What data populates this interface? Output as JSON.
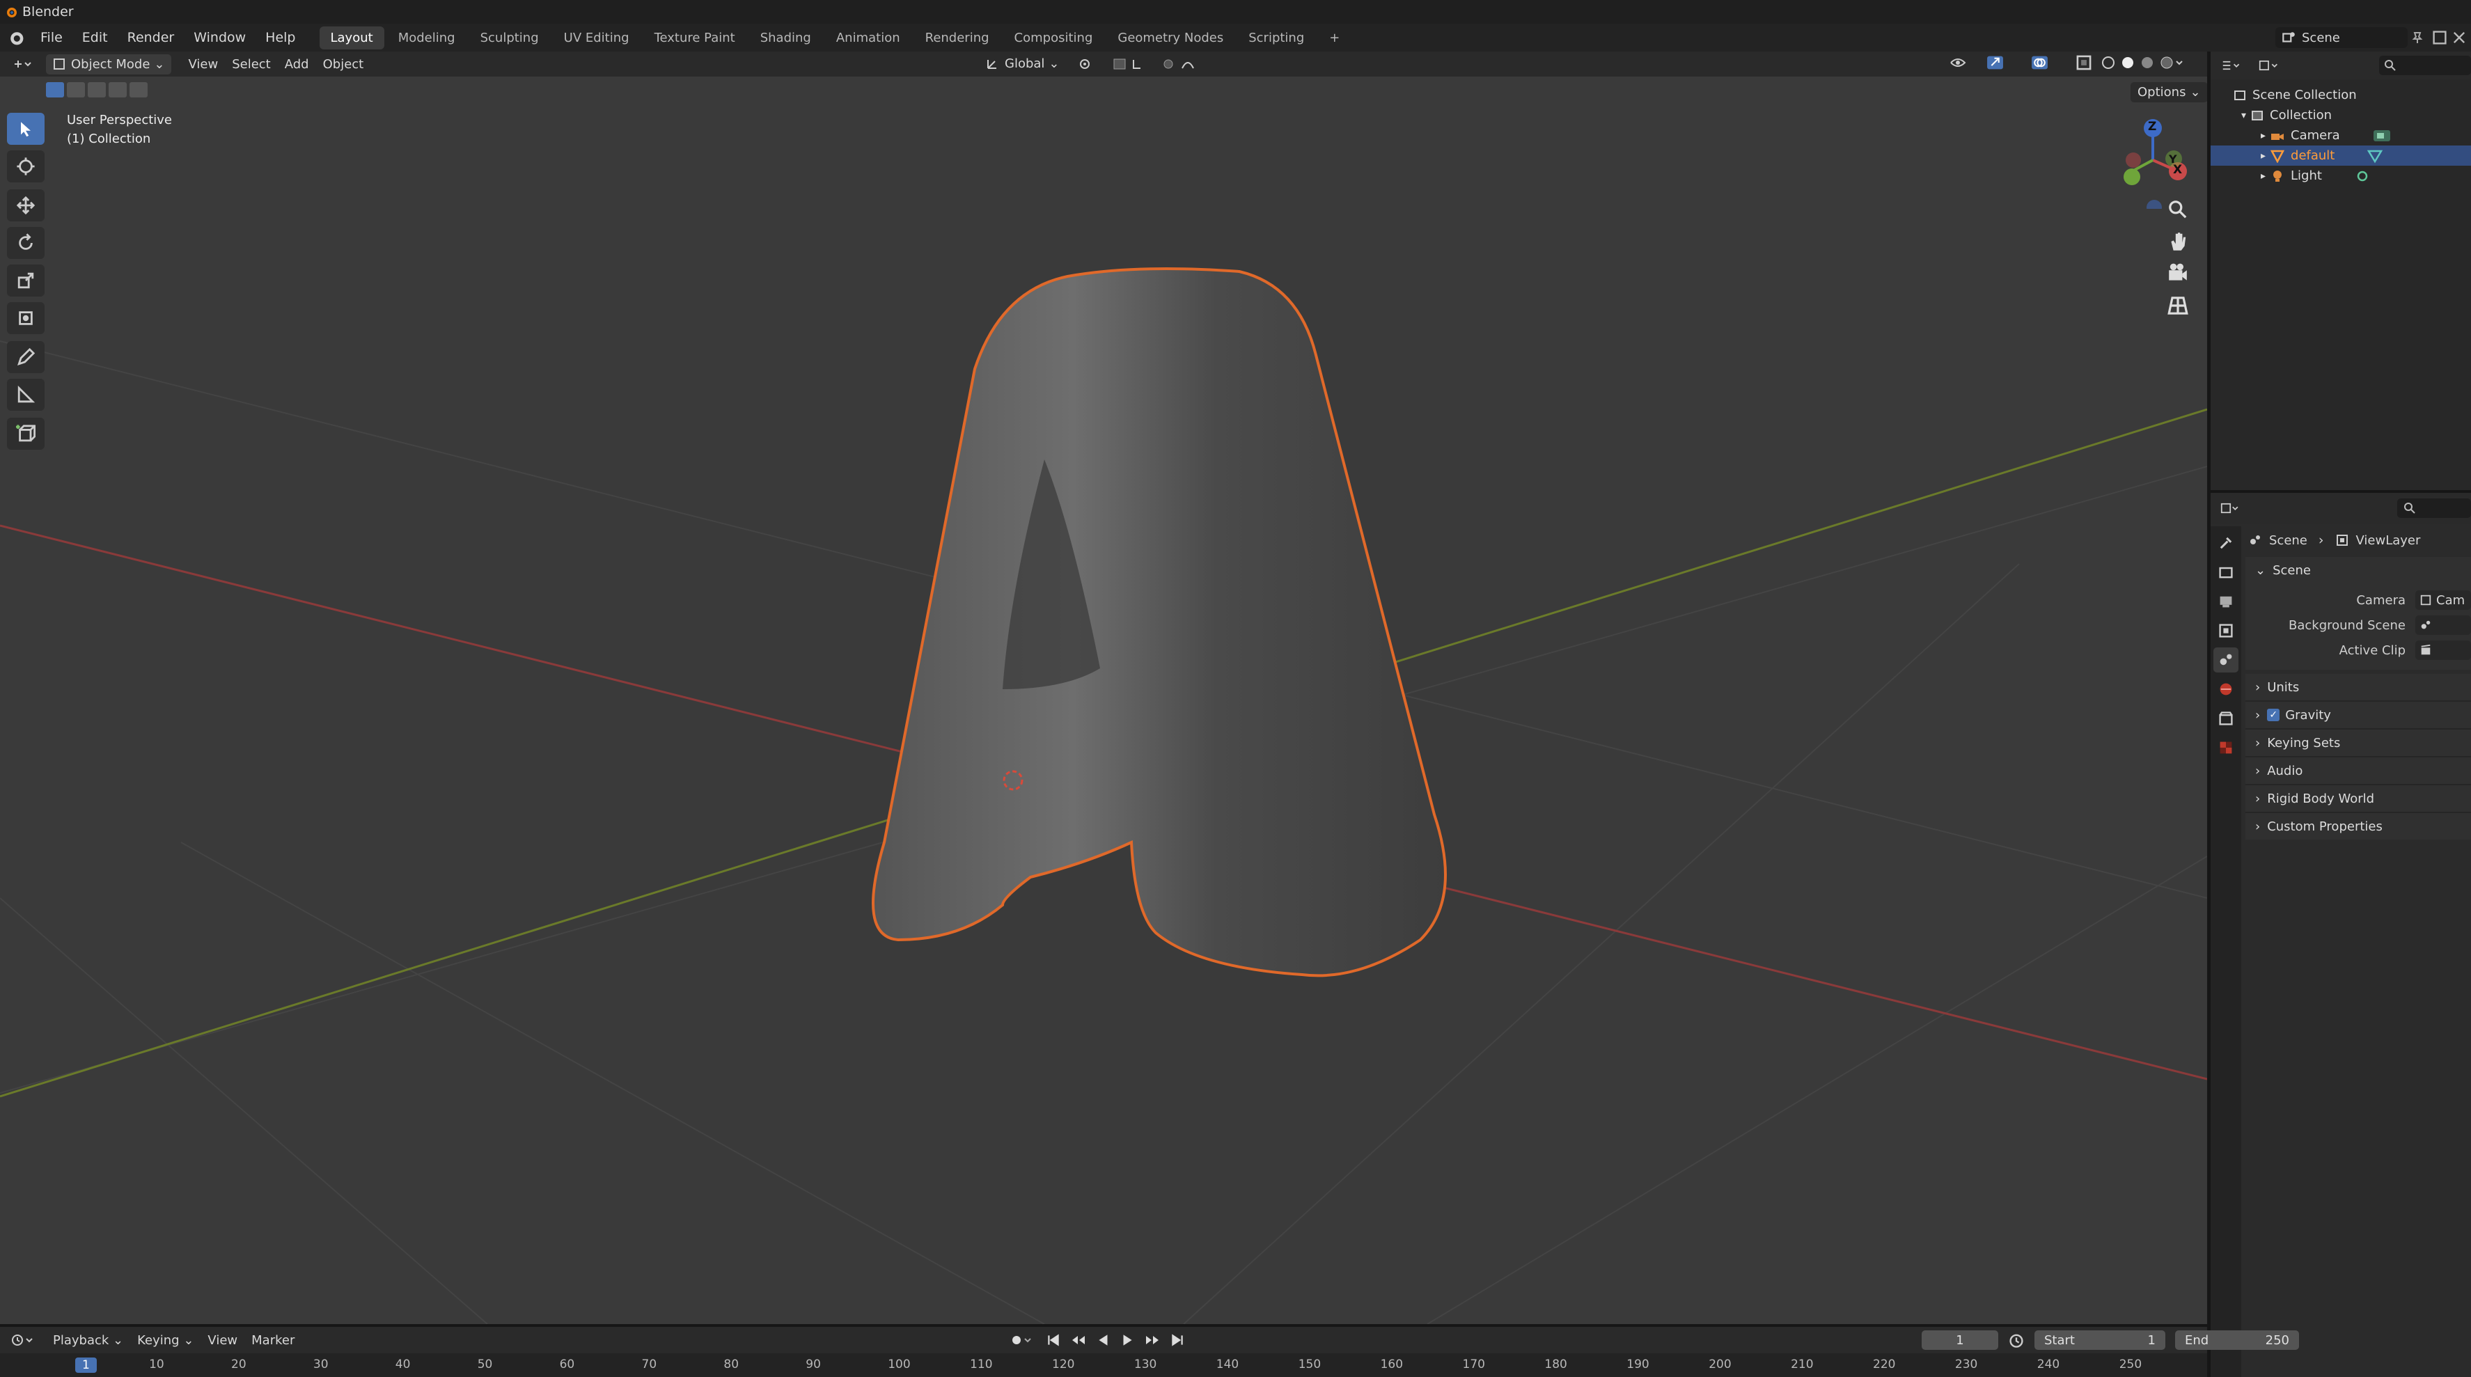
{
  "app": {
    "title": "Blender"
  },
  "menu": [
    "File",
    "Edit",
    "Render",
    "Window",
    "Help"
  ],
  "workspaces": [
    "Layout",
    "Modeling",
    "Sculpting",
    "UV Editing",
    "Texture Paint",
    "Shading",
    "Animation",
    "Rendering",
    "Compositing",
    "Geometry Nodes",
    "Scripting"
  ],
  "workspace_add": "+",
  "scene_name": "Scene",
  "viewport_header": {
    "mode": "Object Mode",
    "menus": [
      "View",
      "Select",
      "Add",
      "Object"
    ],
    "orientation": "Global",
    "options": "Options"
  },
  "viewport": {
    "perspective_label": "User Perspective",
    "collection_label": "(1) Collection",
    "gizmo_axes": {
      "z": "Z",
      "y": "Y",
      "x": "X"
    }
  },
  "outliner": {
    "root": "Scene Collection",
    "collection": "Collection",
    "items": [
      "Camera",
      "default",
      "Light"
    ]
  },
  "properties": {
    "breadcrumb": [
      "Scene",
      "ViewLayer"
    ],
    "panel": "Scene",
    "fields": [
      {
        "label": "Camera",
        "value": "Cam"
      },
      {
        "label": "Background Scene",
        "value": ""
      },
      {
        "label": "Active Clip",
        "value": ""
      }
    ],
    "subpanels": [
      "Units",
      "Gravity",
      "Keying Sets",
      "Audio",
      "Rigid Body World",
      "Custom Properties"
    ]
  },
  "timeline": {
    "menus": [
      "Playback",
      "Keying",
      "View",
      "Marker"
    ],
    "current_frame": "1",
    "start_label": "Start",
    "start": "1",
    "end_label": "End",
    "end": "250",
    "ticks": [
      "1",
      "10",
      "20",
      "30",
      "40",
      "50",
      "60",
      "70",
      "80",
      "90",
      "100",
      "110",
      "120",
      "130",
      "140",
      "150",
      "160",
      "170",
      "180",
      "190",
      "200",
      "210",
      "220",
      "230",
      "240",
      "250"
    ]
  },
  "colors": {
    "accent": "#4772b3",
    "selection_outline": "#e0692a",
    "active_item": "#ff9c3a"
  }
}
